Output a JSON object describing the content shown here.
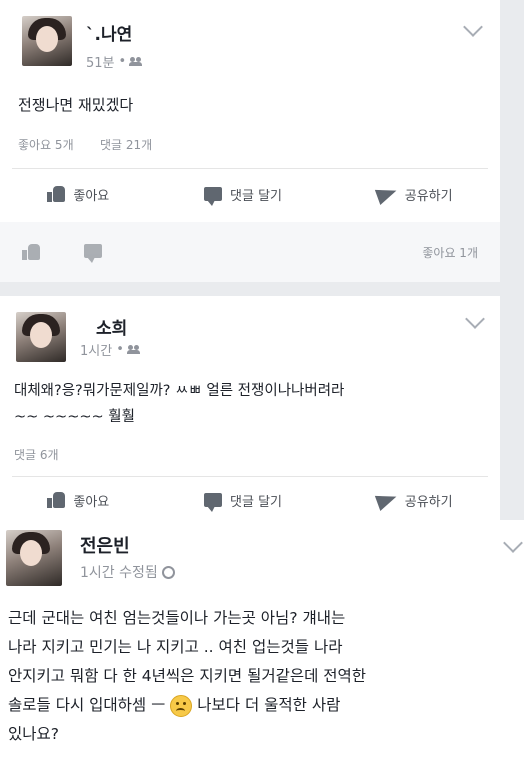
{
  "post1": {
    "author": "`.나연",
    "time": "51분",
    "dot": "•",
    "body": "전쟁나면 재밌겠다",
    "likes": "좋아요 5개",
    "comments": "댓글 21개",
    "actions": {
      "like": "좋아요",
      "comment": "댓글 달기",
      "share": "공유하기"
    },
    "footer_likes": "좋아요 1개"
  },
  "post2": {
    "author": "소희",
    "time": "1시간",
    "dot": "•",
    "body": "대체왜?응?뭐가문제일까? ㅆㅃ 얼른 전쟁이나나버려라\n~~ ~~~~~ 훨훨",
    "comments": "댓글 6개",
    "actions": {
      "like": "좋아요",
      "comment": "댓글 달기",
      "share": "공유하기"
    }
  },
  "post3": {
    "author": "전은빈",
    "time": "1시간 수정됨",
    "body_part1": "근데 군대는 여친 엄는것들이나 가는곳 아님? 걔내는\n나라 지키고 민기는 나 지키고 .. 여친 업는것들 나라\n안지키고 뭐함 다 한 4년씩은 지키면 될거같은데 전역한\n솔로들 다시 입대하셈 ㅡ ",
    "body_part2": " 나보다 더 울적한 사람\n있나요?"
  },
  "icons": [
    "chevron-down-icon",
    "friends-icon",
    "like-icon",
    "comment-icon",
    "share-icon",
    "globe-icon",
    "sad-emoji-icon"
  ]
}
